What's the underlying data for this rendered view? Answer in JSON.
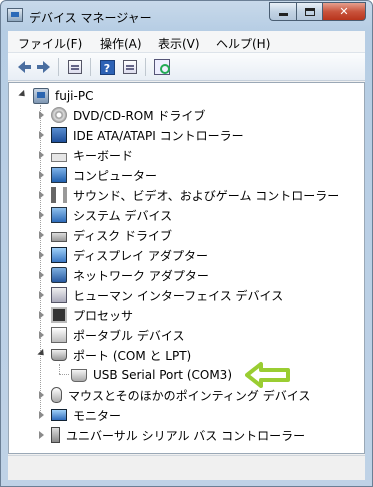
{
  "window": {
    "title": "デバイス マネージャー",
    "caption_close": "✕"
  },
  "menubar": {
    "items": [
      "ファイル(F)",
      "操作(A)",
      "表示(V)",
      "ヘルプ(H)"
    ]
  },
  "toolbar": {
    "buttons": [
      "back-icon",
      "forward-icon",
      "show-hide-console-tree-icon",
      "help-icon",
      "properties-icon",
      "scan-hardware-changes-icon"
    ],
    "help_glyph": "?"
  },
  "tree": {
    "root": "fuji-PC",
    "nodes": [
      {
        "label": "DVD/CD-ROM ドライブ",
        "icon": "dvd-drive-icon"
      },
      {
        "label": "IDE ATA/ATAPI コントローラー",
        "icon": "ide-controller-icon"
      },
      {
        "label": "キーボード",
        "icon": "keyboard-icon"
      },
      {
        "label": "コンピューター",
        "icon": "computer-icon"
      },
      {
        "label": "サウンド、ビデオ、およびゲーム コントローラー",
        "icon": "sound-icon"
      },
      {
        "label": "システム デバイス",
        "icon": "system-devices-icon"
      },
      {
        "label": "ディスク ドライブ",
        "icon": "disk-drive-icon"
      },
      {
        "label": "ディスプレイ アダプター",
        "icon": "display-adapter-icon"
      },
      {
        "label": "ネットワーク アダプター",
        "icon": "network-adapter-icon"
      },
      {
        "label": "ヒューマン インターフェイス デバイス",
        "icon": "hid-icon"
      },
      {
        "label": "プロセッサ",
        "icon": "processor-icon"
      },
      {
        "label": "ポータブル デバイス",
        "icon": "portable-devices-icon"
      },
      {
        "label": "ポート (COM と LPT)",
        "icon": "ports-icon",
        "expanded": true
      },
      {
        "label": "USB Serial Port (COM3)",
        "icon": "usb-serial-port-icon",
        "child": true
      },
      {
        "label": "マウスとそのほかのポインティング デバイス",
        "icon": "mouse-icon"
      },
      {
        "label": "モニター",
        "icon": "monitor-icon"
      },
      {
        "label": "ユニバーサル シリアル バス コントローラー",
        "icon": "usb-controller-icon"
      }
    ]
  },
  "annotation": {
    "arrow_color": "#9acd32"
  }
}
